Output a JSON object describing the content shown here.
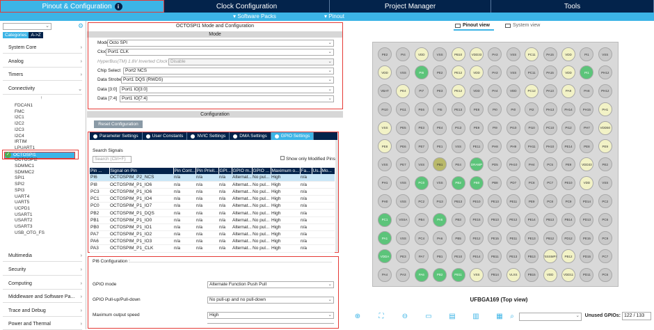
{
  "topnav": [
    {
      "label": "Pinout & Configuration",
      "active": true
    },
    {
      "label": "Clock Configuration"
    },
    {
      "label": "Project Manager"
    },
    {
      "label": "Tools"
    }
  ],
  "subnav": {
    "software_packs": "Software Packs",
    "pinout": "Pinout"
  },
  "left": {
    "tabs": {
      "categories": "Categories",
      "az": "A->Z"
    },
    "categories_top": [
      "System Core",
      "Analog",
      "Timers",
      "Connectivity"
    ],
    "peripherals": [
      "FDCAN1",
      "FMC",
      "I2C1",
      "I2C2",
      "I2C3",
      "I2C4",
      "IRTIM",
      "LPUART1",
      "OCTOSPI1",
      "OCTOSPI2",
      "SDMMC1",
      "SDMMC2",
      "SPI1",
      "SPI2",
      "SPI3",
      "UART4",
      "UART5",
      "UCPD1",
      "USART1",
      "USART2",
      "USART3",
      "USB_OTG_FS"
    ],
    "categories_bottom": [
      "Multimedia",
      "Security",
      "Computing",
      "Middleware and Software Pa...",
      "Trace and Debug",
      "Power and Thermal"
    ]
  },
  "mid": {
    "title": "OCTOSPI1 Mode and Configuration",
    "mode_bar": "Mode",
    "mode_rows": [
      {
        "label": "Mode",
        "value": "Octo SPI"
      },
      {
        "label": "Clock",
        "value": "Port1 CLK"
      },
      {
        "label": "HyperBus(TM) 1.8V Inverted Clock",
        "value": "Disable",
        "disabled": true
      },
      {
        "label": "Chip Select",
        "value": "Port2 NCS"
      },
      {
        "label": "Data Strobe",
        "value": "Port1 DQS (RWDS)"
      },
      {
        "label": "Data [3:0]",
        "value": "Port1 IO[3:0]"
      },
      {
        "label": "Data [7:4]",
        "value": "Port1 IO[7:4]"
      }
    ],
    "config_bar": "Configuration",
    "reset": "Reset Configuration",
    "settings_tabs": [
      "Parameter Settings",
      "User Constants",
      "NVIC Settings",
      "DMA Settings",
      "GPIO Settings"
    ],
    "search_label": "Search Signals",
    "search_placeholder": "Search (Ctrl+F)",
    "show_modified": "Show only Modified Pins",
    "columns": [
      "Pin ...",
      "Signal on Pin",
      "Pin Cont...",
      "Pin Privil...",
      "GPI...",
      "GPIO m...",
      "GPIO ...",
      "Maximum o...",
      "Fa...",
      "Us...",
      "Mo..."
    ],
    "rows": [
      [
        "PI6",
        "OCTOSPIM_P2_NCS",
        "n/a",
        "n/a",
        "n/a",
        "Alternat...",
        "No pul...",
        "High",
        "n/a",
        "",
        ""
      ],
      [
        "PI8",
        "OCTOSPIM_P1_IO6",
        "n/a",
        "n/a",
        "n/a",
        "Alternat...",
        "No pul...",
        "High",
        "n/a",
        "",
        ""
      ],
      [
        "PC3",
        "OCTOSPIM_P1_IO6",
        "n/a",
        "n/a",
        "n/a",
        "Alternat...",
        "No pul...",
        "High",
        "n/a",
        "",
        ""
      ],
      [
        "PC1",
        "OCTOSPIM_P1_IO4",
        "n/a",
        "n/a",
        "n/a",
        "Alternat...",
        "No pul...",
        "High",
        "n/a",
        "",
        ""
      ],
      [
        "PC0",
        "OCTOSPIM_P1_IO7",
        "n/a",
        "n/a",
        "n/a",
        "Alternat...",
        "No pul...",
        "High",
        "n/a",
        "",
        ""
      ],
      [
        "PB2",
        "OCTOSPIM_P1_DQS",
        "n/a",
        "n/a",
        "n/a",
        "Alternat...",
        "No pul...",
        "High",
        "n/a",
        "",
        ""
      ],
      [
        "PB1",
        "OCTOSPIM_P1_IO0",
        "n/a",
        "n/a",
        "n/a",
        "Alternat...",
        "No pul...",
        "High",
        "n/a",
        "",
        ""
      ],
      [
        "PB0",
        "OCTOSPIM_P1_IO1",
        "n/a",
        "n/a",
        "n/a",
        "Alternat...",
        "No pul...",
        "High",
        "n/a",
        "",
        ""
      ],
      [
        "PA7",
        "OCTOSPIM_P1_IO2",
        "n/a",
        "n/a",
        "n/a",
        "Alternat...",
        "No pul...",
        "High",
        "n/a",
        "",
        ""
      ],
      [
        "PA6",
        "OCTOSPIM_P1_IO3",
        "n/a",
        "n/a",
        "n/a",
        "Alternat...",
        "No pul...",
        "High",
        "n/a",
        "",
        ""
      ],
      [
        "PA3",
        "OCTOSPIM_P1_CLK",
        "n/a",
        "n/a",
        "n/a",
        "Alternat...",
        "No pul...",
        "High",
        "n/a",
        "",
        ""
      ]
    ],
    "pin_config_title": "PI6 Configuration :",
    "pin_config_rows": [
      {
        "label": "GPIO mode",
        "value": "Alternate Function Push Pull"
      },
      {
        "label": "GPIO Pull-up/Pull-down",
        "value": "No pull-up and no pull-down"
      },
      {
        "label": "Maximum output speed",
        "value": "High"
      }
    ]
  },
  "right": {
    "pinout_view": "Pinout view",
    "system_view": "System view",
    "chip_label": "UFBGA169 (Top view)",
    "unused_label": "Unused GPIOs:",
    "unused_value": "122 / 133",
    "grid": [
      [
        "PE2",
        "PI4",
        "VDD",
        "VSS",
        "PB10",
        "VDD33",
        "PA3",
        "VSS",
        "PC11",
        "PA15",
        "VDD",
        "PI1",
        "VSS"
      ],
      [
        "VDD",
        "VSS",
        "PI6",
        "PE2",
        "PE12",
        "VDD",
        "PA3",
        "VSS",
        "PC11",
        "PA15",
        "VDD",
        "PI1",
        "PH12"
      ],
      [
        "VBAT",
        "PE4",
        "PI7",
        "PE3",
        "PE12",
        "VDD",
        "PA4",
        "VDD",
        "PC12",
        "PA13",
        "PA9",
        "PA8",
        "PH12"
      ],
      [
        "PI10",
        "PI11",
        "PE6",
        "PI5",
        "PE13",
        "PE8",
        "PI0",
        "PI0",
        "PI2",
        "PH13",
        "PH14",
        "PH15",
        "PH1"
      ],
      [
        "VSS",
        "PE5",
        "PE3",
        "PE4",
        "PI13",
        "PE9",
        "PI9",
        "PI10",
        "PI10",
        "PC10",
        "PI12",
        "PH7",
        "VDD50"
      ],
      [
        "PE8",
        "PE6",
        "PE7",
        "PE1",
        "VSS",
        "PE11",
        "PH8",
        "PH9",
        "PH11",
        "PH10",
        "PE14",
        "PE8",
        "PE9"
      ],
      [
        "VSS",
        "PE7",
        "VSS",
        "PB1",
        "PE4",
        "DRAMP",
        "PD5",
        "PH10",
        "PH4",
        "PC5",
        "PE9",
        "VDD33",
        "PE2"
      ],
      [
        "PH1",
        "VSS",
        "PC0",
        "VSS",
        "PB2",
        "PB0",
        "PB8",
        "PD7",
        "PC8",
        "PC7",
        "PE10",
        "VDD",
        "VSS"
      ],
      [
        "PH0",
        "VSS",
        "PC2",
        "PI13",
        "PB13",
        "PE10",
        "PE13",
        "PE11",
        "PE9",
        "PC8",
        "PC9",
        "PD14",
        "PC2"
      ],
      [
        "PC1",
        "VSSA",
        "PB4",
        "PA6",
        "PB3",
        "PE15",
        "PB13",
        "PE12",
        "PE14",
        "PB13",
        "PB14",
        "PD13",
        "PC6"
      ],
      [
        "PA1",
        "VSS",
        "PC4",
        "PA6",
        "PB5",
        "PE12",
        "PE15",
        "PE11",
        "PE13",
        "PB12",
        "PD12",
        "PE15",
        "PC9"
      ],
      [
        "VDDA",
        "PE3",
        "PA7",
        "PB1",
        "PE10",
        "PE14",
        "PB11",
        "PE13",
        "PB13",
        "VSSSMPS",
        "PB12",
        "PD15",
        "PC7"
      ],
      [
        "PA4",
        "PA3",
        "PA6",
        "PB2",
        "PB11",
        "VSS",
        "PB14",
        "VLXS",
        "PB15",
        "VDD",
        "VDD11",
        "PD11",
        "PC6"
      ]
    ]
  }
}
